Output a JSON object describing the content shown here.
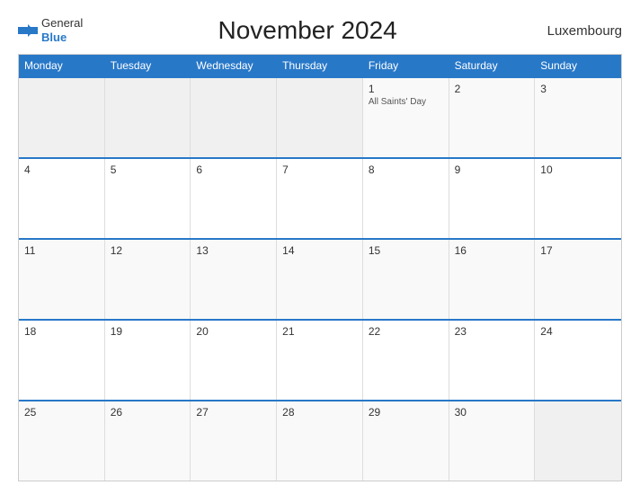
{
  "header": {
    "title": "November 2024",
    "country": "Luxembourg",
    "logo_line1": "General",
    "logo_line2": "Blue"
  },
  "days": {
    "headers": [
      "Monday",
      "Tuesday",
      "Wednesday",
      "Thursday",
      "Friday",
      "Saturday",
      "Sunday"
    ]
  },
  "weeks": [
    {
      "cells": [
        {
          "num": "",
          "empty": true
        },
        {
          "num": "",
          "empty": true
        },
        {
          "num": "",
          "empty": true
        },
        {
          "num": "",
          "empty": true
        },
        {
          "num": "1",
          "holiday": "All Saints' Day"
        },
        {
          "num": "2"
        },
        {
          "num": "3"
        }
      ]
    },
    {
      "cells": [
        {
          "num": "4"
        },
        {
          "num": "5"
        },
        {
          "num": "6"
        },
        {
          "num": "7"
        },
        {
          "num": "8"
        },
        {
          "num": "9"
        },
        {
          "num": "10"
        }
      ]
    },
    {
      "cells": [
        {
          "num": "11"
        },
        {
          "num": "12"
        },
        {
          "num": "13"
        },
        {
          "num": "14"
        },
        {
          "num": "15"
        },
        {
          "num": "16"
        },
        {
          "num": "17"
        }
      ]
    },
    {
      "cells": [
        {
          "num": "18"
        },
        {
          "num": "19"
        },
        {
          "num": "20"
        },
        {
          "num": "21"
        },
        {
          "num": "22"
        },
        {
          "num": "23"
        },
        {
          "num": "24"
        }
      ]
    },
    {
      "cells": [
        {
          "num": "25"
        },
        {
          "num": "26"
        },
        {
          "num": "27"
        },
        {
          "num": "28"
        },
        {
          "num": "29"
        },
        {
          "num": "30"
        },
        {
          "num": "",
          "empty": true
        }
      ]
    }
  ]
}
